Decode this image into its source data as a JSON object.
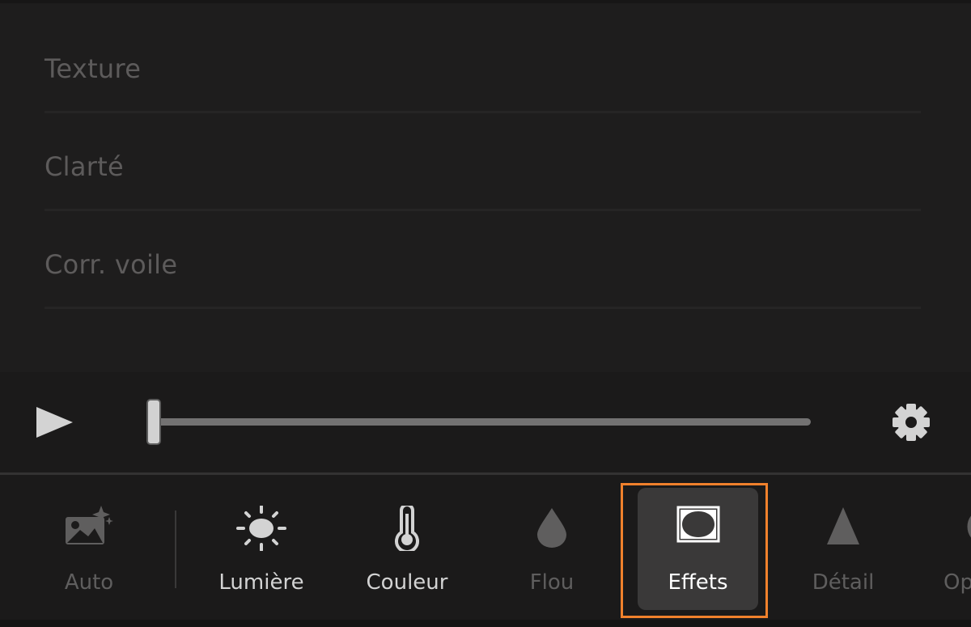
{
  "adjustments": {
    "items": [
      {
        "label": "Texture"
      },
      {
        "label": "Clarté"
      },
      {
        "label": "Corr. voile"
      }
    ]
  },
  "playback": {
    "play_icon": "play-icon",
    "settings_icon": "gear-icon",
    "slider_position": 0
  },
  "toolbar": {
    "tools": [
      {
        "label": "Auto",
        "icon": "auto-image-sparkle-icon",
        "enabled": false
      },
      {
        "label": "Lumière",
        "icon": "sun-icon",
        "enabled": true
      },
      {
        "label": "Couleur",
        "icon": "thermometer-icon",
        "enabled": true
      },
      {
        "label": "Flou",
        "icon": "drop-icon",
        "enabled": false
      },
      {
        "label": "Effets",
        "icon": "vignette-icon",
        "enabled": true,
        "selected": true
      },
      {
        "label": "Détail",
        "icon": "triangle-icon",
        "enabled": false
      },
      {
        "label": "Op",
        "icon": "circle-icon",
        "enabled": false
      }
    ]
  },
  "colors": {
    "background": "#1e1d1d",
    "highlight": "#f0812c",
    "selected_bg": "#3a3939"
  }
}
